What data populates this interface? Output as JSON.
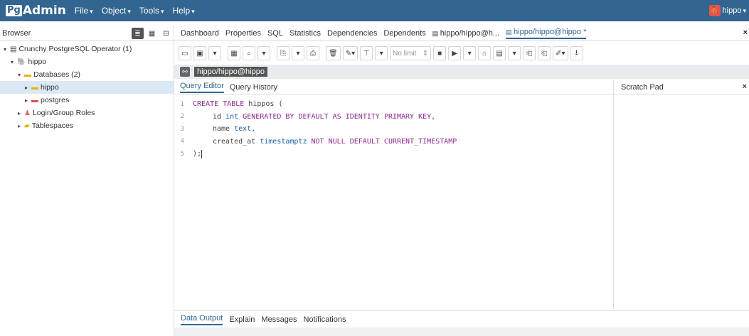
{
  "app": {
    "logo_pg": "Pg",
    "logo_admin": "Admin"
  },
  "menus": [
    "File",
    "Object",
    "Tools",
    "Help"
  ],
  "user": {
    "name": "hippo"
  },
  "browser": {
    "title": "Browser",
    "tree": [
      {
        "label": "Crunchy PostgreSQL Operator (1)",
        "depth": 0
      },
      {
        "label": "hippo",
        "depth": 1
      },
      {
        "label": "Databases (2)",
        "depth": 2
      },
      {
        "label": "hippo",
        "depth": 3,
        "selected": true
      },
      {
        "label": "postgres",
        "depth": 3
      },
      {
        "label": "Login/Group Roles",
        "depth": 2
      },
      {
        "label": "Tablespaces",
        "depth": 2
      }
    ]
  },
  "tabs": [
    "Dashboard",
    "Properties",
    "SQL",
    "Statistics",
    "Dependencies",
    "Dependents",
    "hippo/hippo@h...",
    "hippo/hippo@hippo *"
  ],
  "toolbar": {
    "row_limit": "No limit"
  },
  "connection": {
    "label": "hippo/hippo@hippo"
  },
  "editor": {
    "tabs": [
      "Query Editor",
      "Query History"
    ],
    "scratch_pad": "Scratch Pad",
    "lines": [
      "CREATE TABLE hippos (",
      "id int GENERATED BY DEFAULT AS IDENTITY PRIMARY KEY,",
      "name text,",
      "created_at timestamptz NOT NULL DEFAULT CURRENT_TIMESTAMP",
      ");"
    ]
  },
  "bottom_tabs": [
    "Data Output",
    "Explain",
    "Messages",
    "Notifications"
  ]
}
